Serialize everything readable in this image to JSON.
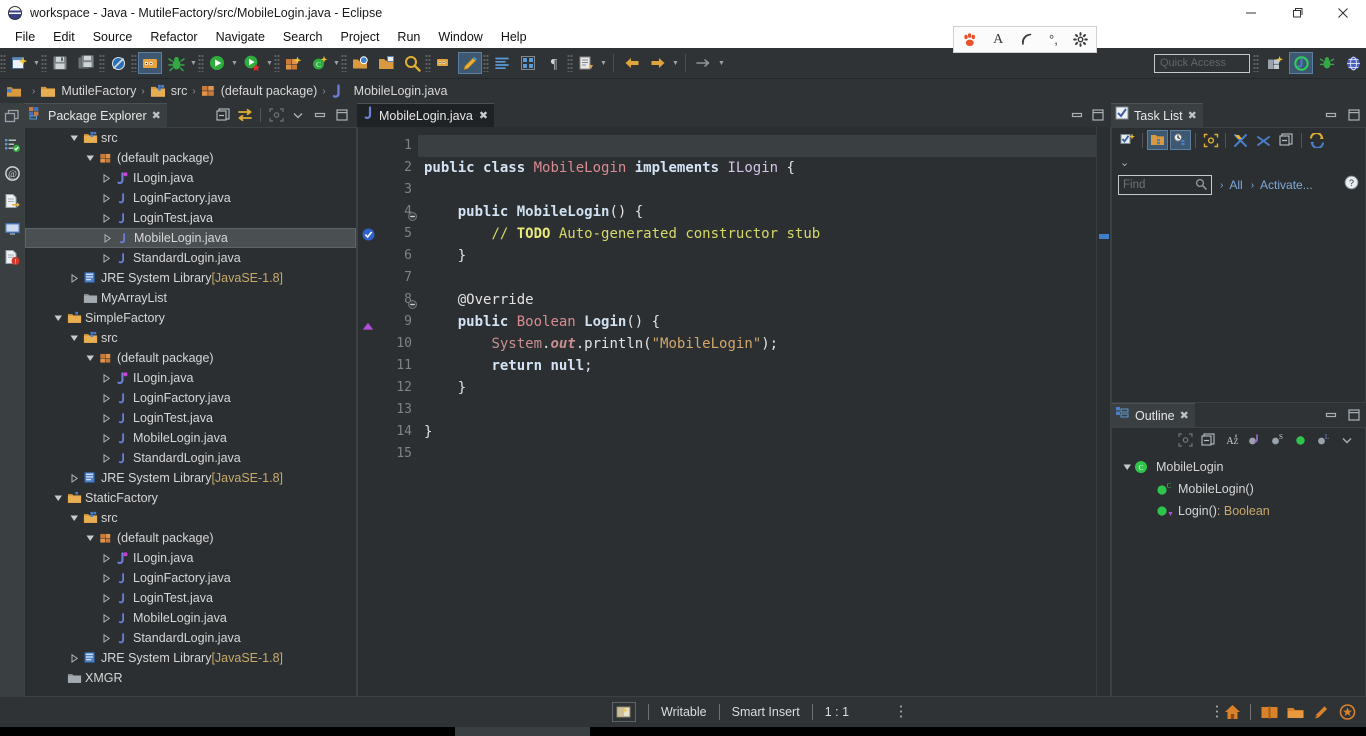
{
  "window": {
    "title": "workspace - Java - MutileFactory/src/MobileLogin.java - Eclipse",
    "minimize_label": "—",
    "maximize_label": "❐",
    "close_label": "✕"
  },
  "menu": {
    "items": [
      {
        "label": "File"
      },
      {
        "label": "Edit"
      },
      {
        "label": "Source"
      },
      {
        "label": "Refactor"
      },
      {
        "label": "Navigate"
      },
      {
        "label": "Search"
      },
      {
        "label": "Project"
      },
      {
        "label": "Run"
      },
      {
        "label": "Window"
      },
      {
        "label": "Help"
      }
    ]
  },
  "ime_bar": {
    "icons": [
      "paw-icon",
      "letter-a-icon",
      "moon-icon",
      "comma-icon",
      "gear-icon"
    ]
  },
  "toolbar": {
    "quick_access_placeholder": "Quick Access",
    "buttons": [
      "new-wizard-icon",
      "save-icon",
      "save-all-icon",
      "toggle-breakpoint-icon",
      "debug-perspective-icon",
      "debug-icon",
      "run-icon",
      "run-error-icon",
      "new-java-project-icon",
      "new-class-icon",
      "open-type-icon",
      "open-task-icon",
      "search-icon",
      "last-edit-icon",
      "edit-icon",
      "toggle-markers-icon",
      "toggle-breadcrumb-icon",
      "pilcrow-icon",
      "next-annotation-icon",
      "previous-annotation-icon",
      "back-icon",
      "forward-icon"
    ],
    "perspectives": [
      "new-perspective-icon",
      "java-perspective-icon",
      "debug-perspective-icon",
      "browser-perspective-icon"
    ]
  },
  "breadcrumb": {
    "items": [
      {
        "label": "MutileFactory",
        "icon": "project-icon"
      },
      {
        "label": "src",
        "icon": "source-folder-icon"
      },
      {
        "label": "(default package)",
        "icon": "package-icon"
      },
      {
        "label": "MobileLogin.java",
        "icon": "java-file-icon"
      }
    ],
    "separator": "›"
  },
  "rail": {
    "icons": [
      "restore-icon",
      "task-list-icon",
      "javadoc-icon",
      "declaration-icon",
      "console-icon",
      "problems-icon"
    ]
  },
  "package_explorer": {
    "title": "Package Explorer",
    "close_label": "✖",
    "tools": [
      "collapse-all-icon",
      "link-with-editor-icon",
      "focus-icon",
      "view-menu-icon",
      "minimize-icon",
      "maximize-icon"
    ],
    "tree": [
      {
        "depth": 2,
        "arrow": "down",
        "icon": "source-folder",
        "label": "src"
      },
      {
        "depth": 3,
        "arrow": "down",
        "icon": "package",
        "label": "(default package)"
      },
      {
        "depth": 4,
        "arrow": "right",
        "icon": "java-interface",
        "label": "ILogin.java"
      },
      {
        "depth": 4,
        "arrow": "right",
        "icon": "java-class",
        "label": "LoginFactory.java"
      },
      {
        "depth": 4,
        "arrow": "right",
        "icon": "java-class",
        "label": "LoginTest.java"
      },
      {
        "depth": 4,
        "arrow": "right",
        "icon": "java-class",
        "label": "MobileLogin.java",
        "selected": true
      },
      {
        "depth": 4,
        "arrow": "right",
        "icon": "java-class",
        "label": "StandardLogin.java"
      },
      {
        "depth": 2,
        "arrow": "right",
        "icon": "library",
        "label": "JRE System Library ",
        "suffix": "[JavaSE-1.8]"
      },
      {
        "depth": 2,
        "arrow": "none",
        "icon": "closed-project",
        "label": "MyArrayList"
      },
      {
        "depth": 1,
        "arrow": "down",
        "icon": "project",
        "label": "SimpleFactory"
      },
      {
        "depth": 2,
        "arrow": "down",
        "icon": "source-folder",
        "label": "src"
      },
      {
        "depth": 3,
        "arrow": "down",
        "icon": "package",
        "label": "(default package)"
      },
      {
        "depth": 4,
        "arrow": "right",
        "icon": "java-interface",
        "label": "ILogin.java"
      },
      {
        "depth": 4,
        "arrow": "right",
        "icon": "java-class",
        "label": "LoginFactory.java"
      },
      {
        "depth": 4,
        "arrow": "right",
        "icon": "java-class",
        "label": "LoginTest.java"
      },
      {
        "depth": 4,
        "arrow": "right",
        "icon": "java-class",
        "label": "MobileLogin.java"
      },
      {
        "depth": 4,
        "arrow": "right",
        "icon": "java-class",
        "label": "StandardLogin.java"
      },
      {
        "depth": 2,
        "arrow": "right",
        "icon": "library",
        "label": "JRE System Library ",
        "suffix": "[JavaSE-1.8]"
      },
      {
        "depth": 1,
        "arrow": "down",
        "icon": "project",
        "label": "StaticFactory"
      },
      {
        "depth": 2,
        "arrow": "down",
        "icon": "source-folder",
        "label": "src"
      },
      {
        "depth": 3,
        "arrow": "down",
        "icon": "package",
        "label": "(default package)"
      },
      {
        "depth": 4,
        "arrow": "right",
        "icon": "java-interface",
        "label": "ILogin.java"
      },
      {
        "depth": 4,
        "arrow": "right",
        "icon": "java-class",
        "label": "LoginFactory.java"
      },
      {
        "depth": 4,
        "arrow": "right",
        "icon": "java-class",
        "label": "LoginTest.java"
      },
      {
        "depth": 4,
        "arrow": "right",
        "icon": "java-class",
        "label": "MobileLogin.java"
      },
      {
        "depth": 4,
        "arrow": "right",
        "icon": "java-class",
        "label": "StandardLogin.java"
      },
      {
        "depth": 2,
        "arrow": "right",
        "icon": "library",
        "label": "JRE System Library ",
        "suffix": "[JavaSE-1.8]"
      },
      {
        "depth": 1,
        "arrow": "none",
        "icon": "closed-project",
        "label": "XMGR"
      }
    ]
  },
  "editor": {
    "tab_label": "MobileLogin.java",
    "tab_close": "✖",
    "tools": [
      "minimize-icon",
      "maximize-icon"
    ],
    "lines": [
      {
        "no": "1",
        "marker": "",
        "tokens": []
      },
      {
        "no": "2",
        "marker": "",
        "tokens": [
          {
            "t": "public ",
            "c": "k"
          },
          {
            "t": "class ",
            "c": "k"
          },
          {
            "t": "MobileLogin",
            "c": "cls"
          },
          {
            "t": " ",
            "c": "pln"
          },
          {
            "t": "implements",
            "c": "k"
          },
          {
            "t": " ",
            "c": "pln"
          },
          {
            "t": "ILogin",
            "c": "ifc"
          },
          {
            "t": " {",
            "c": "pln"
          }
        ]
      },
      {
        "no": "3",
        "marker": "",
        "tokens": []
      },
      {
        "no": "4",
        "marker": "collapse",
        "tokens": [
          {
            "t": "    ",
            "c": "pln"
          },
          {
            "t": "public ",
            "c": "k"
          },
          {
            "t": "MobileLogin",
            "c": "mtd"
          },
          {
            "t": "() {",
            "c": "pln"
          }
        ]
      },
      {
        "no": "5",
        "marker": "",
        "leftmark": "todo-check",
        "tokens": [
          {
            "t": "        ",
            "c": "pln"
          },
          {
            "t": "// ",
            "c": "cmt"
          },
          {
            "t": "TODO",
            "c": "todo"
          },
          {
            "t": " Auto-generated constructor stub",
            "c": "cmt"
          }
        ]
      },
      {
        "no": "6",
        "marker": "",
        "tokens": [
          {
            "t": "    }",
            "c": "pln"
          }
        ]
      },
      {
        "no": "7",
        "marker": "",
        "tokens": []
      },
      {
        "no": "8",
        "marker": "collapse",
        "tokens": [
          {
            "t": "    ",
            "c": "pln"
          },
          {
            "t": "@Override",
            "c": "pln"
          }
        ]
      },
      {
        "no": "9",
        "marker": "",
        "leftmark": "override-triangle",
        "tokens": [
          {
            "t": "    ",
            "c": "pln"
          },
          {
            "t": "public ",
            "c": "k"
          },
          {
            "t": "Boolean ",
            "c": "cls"
          },
          {
            "t": "Login",
            "c": "mtd"
          },
          {
            "t": "() {",
            "c": "pln"
          }
        ]
      },
      {
        "no": "10",
        "marker": "",
        "tokens": [
          {
            "t": "        ",
            "c": "pln"
          },
          {
            "t": "System",
            "c": "fld"
          },
          {
            "t": ".",
            "c": "pln"
          },
          {
            "t": "out",
            "c": "itl"
          },
          {
            "t": ".println(",
            "c": "pln"
          },
          {
            "t": "\"MobileLogin\"",
            "c": "str"
          },
          {
            "t": ");",
            "c": "pln"
          }
        ]
      },
      {
        "no": "11",
        "marker": "",
        "tokens": [
          {
            "t": "        ",
            "c": "pln"
          },
          {
            "t": "return ",
            "c": "k"
          },
          {
            "t": "null",
            "c": "k"
          },
          {
            "t": ";",
            "c": "pln"
          }
        ]
      },
      {
        "no": "12",
        "marker": "",
        "tokens": [
          {
            "t": "    }",
            "c": "pln"
          }
        ]
      },
      {
        "no": "13",
        "marker": "",
        "tokens": []
      },
      {
        "no": "14",
        "marker": "",
        "tokens": [
          {
            "t": "}",
            "c": "pln"
          }
        ]
      },
      {
        "no": "15",
        "marker": "",
        "tokens": []
      }
    ]
  },
  "task_list": {
    "title": "Task List",
    "close_label": "✖",
    "tools": [
      "minimize-icon",
      "maximize-icon"
    ],
    "toolbar_icons": [
      "new-task-icon",
      "categorize-icon",
      "schedule-icon",
      "focus-icon",
      "filter-complete-icon",
      "filter-icon",
      "collapse-all-icon",
      "synchronize-icon"
    ],
    "view_menu": "∨",
    "find_placeholder": "Find",
    "all_label": "All",
    "activate_label": "Activate...",
    "help_label": "?"
  },
  "outline": {
    "title": "Outline",
    "close_label": "✖",
    "tools": [
      "minimize-icon",
      "maximize-icon"
    ],
    "toolbar_icons": [
      "focus-icon",
      "collapse-all-icon",
      "sort-icon",
      "hide-fields-icon",
      "hide-static-icon",
      "hide-nonpublic-icon",
      "hide-local-icon",
      "view-menu-icon"
    ],
    "items": [
      {
        "depth": 0,
        "arrow": "down",
        "icon": "class",
        "label": "MobileLogin",
        "type": ""
      },
      {
        "depth": 1,
        "arrow": "none",
        "icon": "constructor",
        "label": "MobileLogin()",
        "type": ""
      },
      {
        "depth": 1,
        "arrow": "none",
        "icon": "method-override",
        "label": "Login()",
        "type": " : Boolean"
      }
    ]
  },
  "status_bar": {
    "writable": "Writable",
    "insert_mode": "Smart Insert",
    "position": "1 : 1",
    "icons": [
      "home-icon",
      "book-icon",
      "folder-icon",
      "pencil-icon",
      "badge-icon"
    ]
  }
}
